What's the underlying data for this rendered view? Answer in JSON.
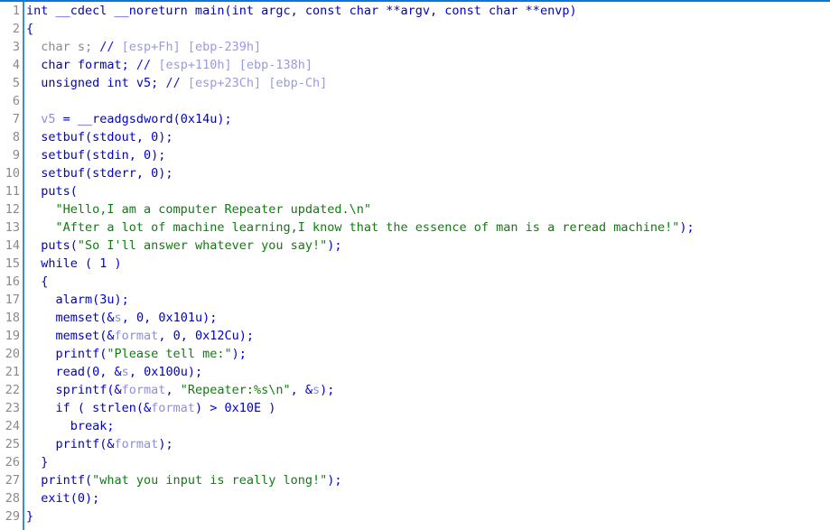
{
  "view": {
    "name": "pseudocode-decompiler-view",
    "top_border_color": "#0a78d4",
    "gutter_divider_color": "#3a8ed0",
    "background": "#ffffff",
    "line_number_color": "#8a8a8a",
    "colors": {
      "keyword": "#0000cc",
      "function": "#0000cc",
      "string": "#107c10",
      "variable": "#8f8fd8",
      "comment_address": "#9a9ae0",
      "comment_marker": "#1515c8",
      "unused": "#8a8a8a"
    }
  },
  "lines": [
    {
      "number": "1",
      "tokens": [
        {
          "class": "t-kw",
          "text": "int __cdecl __noreturn main(int argc, const char **argv, const char **envp)"
        }
      ]
    },
    {
      "number": "2",
      "tokens": [
        {
          "class": "t-punct",
          "text": "{"
        }
      ]
    },
    {
      "number": "3",
      "tokens": [
        {
          "class": "t-unused",
          "text": "  char s; "
        },
        {
          "class": "t-cmtmark",
          "text": "// "
        },
        {
          "class": "t-cmtaddr",
          "text": "[esp+Fh] [ebp-239h]"
        }
      ]
    },
    {
      "number": "4",
      "tokens": [
        {
          "class": "t-kw",
          "text": "  char format; "
        },
        {
          "class": "t-cmtmark",
          "text": "// "
        },
        {
          "class": "t-cmtaddr",
          "text": "[esp+110h] [ebp-138h]"
        }
      ]
    },
    {
      "number": "5",
      "tokens": [
        {
          "class": "t-kw",
          "text": "  unsigned int v5; "
        },
        {
          "class": "t-cmtmark",
          "text": "// "
        },
        {
          "class": "t-cmtaddr",
          "text": "[esp+23Ch] [ebp-Ch]"
        }
      ]
    },
    {
      "number": "6",
      "tokens": []
    },
    {
      "number": "7",
      "tokens": [
        {
          "class": "t-kw",
          "text": "  "
        },
        {
          "class": "t-var",
          "text": "v5"
        },
        {
          "class": "t-kw",
          "text": " = __readgsdword(0x14u);"
        }
      ]
    },
    {
      "number": "8",
      "tokens": [
        {
          "class": "t-kw",
          "text": "  setbuf(stdout, 0);"
        }
      ]
    },
    {
      "number": "9",
      "tokens": [
        {
          "class": "t-kw",
          "text": "  setbuf(stdin, 0);"
        }
      ]
    },
    {
      "number": "10",
      "tokens": [
        {
          "class": "t-kw",
          "text": "  setbuf(stderr, 0);"
        }
      ]
    },
    {
      "number": "11",
      "tokens": [
        {
          "class": "t-kw",
          "text": "  puts("
        }
      ]
    },
    {
      "number": "12",
      "tokens": [
        {
          "class": "t-str",
          "text": "    \"Hello,I am a computer Repeater updated.\\n\""
        }
      ]
    },
    {
      "number": "13",
      "tokens": [
        {
          "class": "t-str",
          "text": "    \"After a lot of machine learning,I know that the essence of man is a reread machine!\""
        },
        {
          "class": "t-kw",
          "text": ");"
        }
      ]
    },
    {
      "number": "14",
      "tokens": [
        {
          "class": "t-kw",
          "text": "  puts("
        },
        {
          "class": "t-str",
          "text": "\"So I'll answer whatever you say!\""
        },
        {
          "class": "t-kw",
          "text": ");"
        }
      ]
    },
    {
      "number": "15",
      "tokens": [
        {
          "class": "t-kw",
          "text": "  while ( 1 )"
        }
      ]
    },
    {
      "number": "16",
      "tokens": [
        {
          "class": "t-punct",
          "text": "  {"
        }
      ]
    },
    {
      "number": "17",
      "tokens": [
        {
          "class": "t-kw",
          "text": "    alarm(3u);"
        }
      ]
    },
    {
      "number": "18",
      "tokens": [
        {
          "class": "t-kw",
          "text": "    memset(&"
        },
        {
          "class": "t-var",
          "text": "s"
        },
        {
          "class": "t-kw",
          "text": ", 0, 0x101u);"
        }
      ]
    },
    {
      "number": "19",
      "tokens": [
        {
          "class": "t-kw",
          "text": "    memset(&"
        },
        {
          "class": "t-var",
          "text": "format"
        },
        {
          "class": "t-kw",
          "text": ", 0, 0x12Cu);"
        }
      ]
    },
    {
      "number": "20",
      "tokens": [
        {
          "class": "t-kw",
          "text": "    printf("
        },
        {
          "class": "t-str",
          "text": "\"Please tell me:\""
        },
        {
          "class": "t-kw",
          "text": ");"
        }
      ]
    },
    {
      "number": "21",
      "tokens": [
        {
          "class": "t-kw",
          "text": "    read(0, &"
        },
        {
          "class": "t-var",
          "text": "s"
        },
        {
          "class": "t-kw",
          "text": ", 0x100u);"
        }
      ]
    },
    {
      "number": "22",
      "tokens": [
        {
          "class": "t-kw",
          "text": "    sprintf(&"
        },
        {
          "class": "t-var",
          "text": "format"
        },
        {
          "class": "t-kw",
          "text": ", "
        },
        {
          "class": "t-str",
          "text": "\"Repeater:%s\\n\""
        },
        {
          "class": "t-kw",
          "text": ", &"
        },
        {
          "class": "t-var",
          "text": "s"
        },
        {
          "class": "t-kw",
          "text": ");"
        }
      ]
    },
    {
      "number": "23",
      "tokens": [
        {
          "class": "t-kw",
          "text": "    if ( strlen(&"
        },
        {
          "class": "t-var",
          "text": "format"
        },
        {
          "class": "t-kw",
          "text": ") > 0x10E )"
        }
      ]
    },
    {
      "number": "24",
      "tokens": [
        {
          "class": "t-kw",
          "text": "      break;"
        }
      ]
    },
    {
      "number": "25",
      "tokens": [
        {
          "class": "t-kw",
          "text": "    printf(&"
        },
        {
          "class": "t-var",
          "text": "format"
        },
        {
          "class": "t-kw",
          "text": ");"
        }
      ]
    },
    {
      "number": "26",
      "tokens": [
        {
          "class": "t-punct",
          "text": "  }"
        }
      ]
    },
    {
      "number": "27",
      "tokens": [
        {
          "class": "t-kw",
          "text": "  printf("
        },
        {
          "class": "t-str",
          "text": "\"what you input is really long!\""
        },
        {
          "class": "t-kw",
          "text": ");"
        }
      ]
    },
    {
      "number": "28",
      "tokens": [
        {
          "class": "t-kw",
          "text": "  exit(0);"
        }
      ]
    },
    {
      "number": "29",
      "tokens": [
        {
          "class": "t-punct",
          "text": "}"
        }
      ]
    }
  ]
}
